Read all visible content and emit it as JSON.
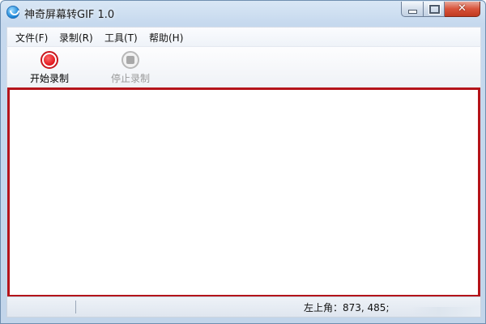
{
  "window": {
    "title": "神奇屏幕转GIF 1.0",
    "close_glyph": "✕"
  },
  "menu": {
    "items": [
      {
        "label": "文件(F)"
      },
      {
        "label": "录制(R)"
      },
      {
        "label": "工具(T)"
      },
      {
        "label": "帮助(H)"
      }
    ]
  },
  "toolbar": {
    "start_label": "开始录制",
    "stop_label": "停止录制",
    "start_icon": "record-icon",
    "stop_icon": "stop-icon",
    "stop_enabled": false
  },
  "status": {
    "position_text": "左上角：873, 485;"
  },
  "colors": {
    "capture_border": "#b4141a",
    "record": "#e0151b"
  }
}
